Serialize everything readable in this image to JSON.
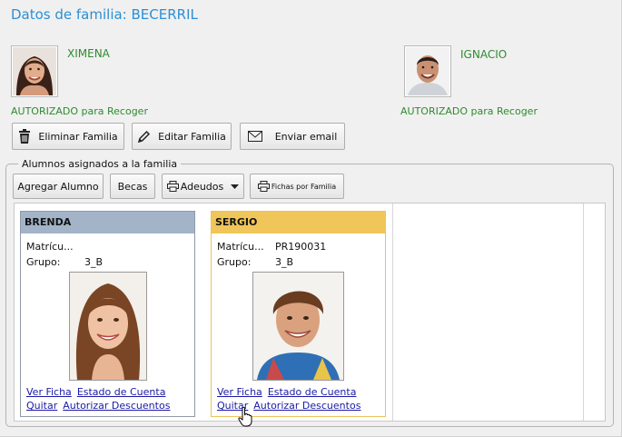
{
  "title": "Datos de familia: BECERRIL",
  "parents": [
    {
      "name": "XIMENA",
      "authorization": "AUTORIZADO para Recoger"
    },
    {
      "name": "IGNACIO",
      "authorization": "AUTORIZADO para Recoger"
    }
  ],
  "actions": {
    "delete_label": "Eliminar Familia",
    "edit_label": "Editar Familia",
    "email_label": "Enviar email"
  },
  "students_group": {
    "label": "Alumnos asignados a la familia",
    "toolbar": {
      "add_label": "Agregar Alumno",
      "grants_label": "Becas",
      "debts_label": "Adeudos",
      "sheets_label": "Fichas por Familia"
    }
  },
  "students": [
    {
      "name": "BRENDA",
      "enrollment_label": "Matrícu...",
      "enrollment_value": "",
      "group_label": "Grupo:",
      "group_value": "3_B",
      "header_color": "#a3b4c8",
      "links": [
        "Ver Ficha",
        "Estado de Cuenta",
        "Quitar",
        "Autorizar Descuentos"
      ]
    },
    {
      "name": "SERGIO",
      "enrollment_label": "Matrícu...",
      "enrollment_value": "PR190031",
      "group_label": "Grupo:",
      "group_value": "3_B",
      "header_color": "#f0c65a",
      "links": [
        "Ver Ficha",
        "Estado de Cuenta",
        "Quitar",
        "Autorizar Descuentos"
      ]
    }
  ],
  "colors": {
    "title": "#2b8fd6",
    "parent_text": "#2e8b2e",
    "link": "#1a1aa6",
    "selected_card_border": "#e8c45a"
  }
}
